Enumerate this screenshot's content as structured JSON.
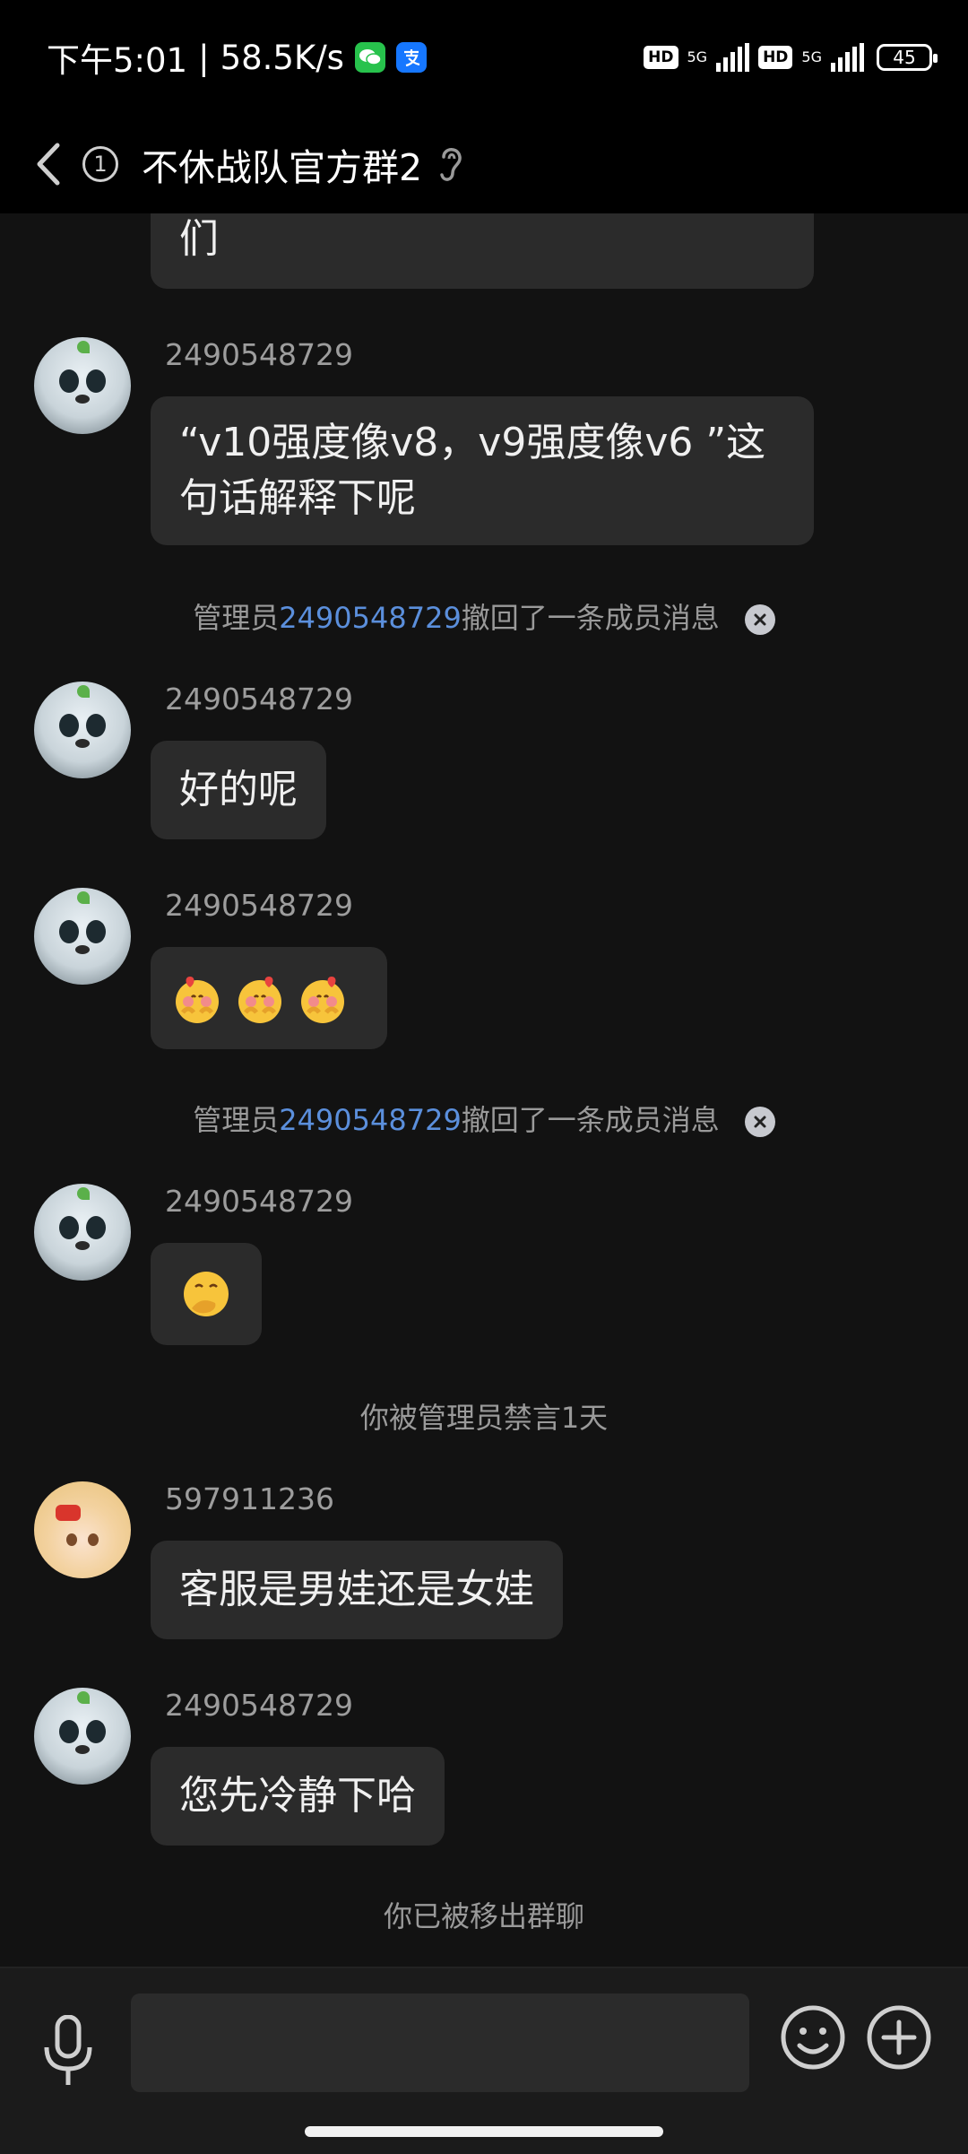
{
  "status_bar": {
    "time": "下午5:01",
    "separator": "|",
    "net_speed": "58.5K/s",
    "hd1": "HD",
    "net1": "5G",
    "hd2": "HD",
    "net2": "5G",
    "battery": "45"
  },
  "header": {
    "unread_count": "1",
    "title": "不休战队官方群2"
  },
  "messages": [
    {
      "type": "bubble",
      "sender": "",
      "text": "们"
    },
    {
      "type": "bubble",
      "sender": "2490548729",
      "lines": [
        "“v10强度像v8，v9强度像v6 ”这",
        "句话解释下呢"
      ]
    },
    {
      "type": "system",
      "prefix": "管理员",
      "link": "2490548729",
      "suffix": "撤回了一条成员消息"
    },
    {
      "type": "bubble",
      "sender": "2490548729",
      "text": "好的呢"
    },
    {
      "type": "emoji",
      "sender": "2490548729",
      "emojis": [
        "shy-heart-emoji",
        "shy-heart-emoji",
        "shy-heart-emoji"
      ]
    },
    {
      "type": "system",
      "prefix": "管理员",
      "link": "2490548729",
      "suffix": "撤回了一条成员消息"
    },
    {
      "type": "emoji",
      "sender": "2490548729",
      "emojis": [
        "covering-mouth-emoji"
      ]
    },
    {
      "type": "system",
      "text": "你被管理员禁言1天"
    },
    {
      "type": "bubble",
      "sender": "597911236",
      "text": "客服是男娃还是女娃"
    },
    {
      "type": "bubble",
      "sender": "2490548729",
      "text": "您先冷静下哈"
    },
    {
      "type": "system",
      "text": "你已被移出群聊"
    }
  ],
  "input_bar": {
    "placeholder": "",
    "icons": [
      "mic-icon",
      "smile-icon",
      "plus-icon"
    ]
  },
  "colors": {
    "background": "#121212",
    "bubble": "#2b2b2b",
    "link": "#5b8fdc",
    "system_text": "#9a9a9a"
  }
}
